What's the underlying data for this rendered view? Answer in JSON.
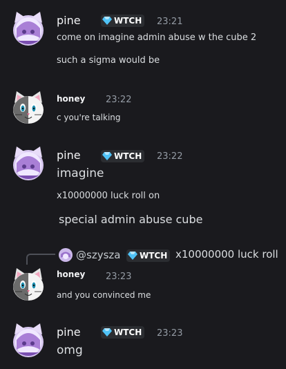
{
  "colors": {
    "background": "#1a1a1e",
    "tag_bg": "#2b2d31",
    "gem": "#4fc3f7",
    "timestamp": "#949ba4"
  },
  "messages": [
    {
      "user": "pine",
      "avatar": "pine-cat-avatar",
      "tag": "WTCH",
      "time": "23:21",
      "lines": [
        "come on imagine admin abuse w the cube 2",
        "such a sigma would be"
      ]
    },
    {
      "user": "honey",
      "avatar": "honey-cat-avatar",
      "time": "23:22",
      "lines": [
        "c you're talking"
      ]
    },
    {
      "user": "pine",
      "avatar": "pine-cat-avatar",
      "tag": "WTCH",
      "time": "23:22",
      "lines": [
        "imagine",
        "x10000000 luck roll on",
        "special admin abuse cube"
      ]
    },
    {
      "user": "honey",
      "avatar": "honey-cat-avatar",
      "time": "23:23",
      "reply": {
        "user": "@szysza",
        "tag": "WTCH",
        "text": "x10000000 luck roll"
      },
      "lines": [
        "and you convinced me"
      ]
    },
    {
      "user": "pine",
      "avatar": "pine-cat-avatar",
      "tag": "WTCH",
      "time": "23:23",
      "lines": [
        "omg"
      ]
    }
  ]
}
